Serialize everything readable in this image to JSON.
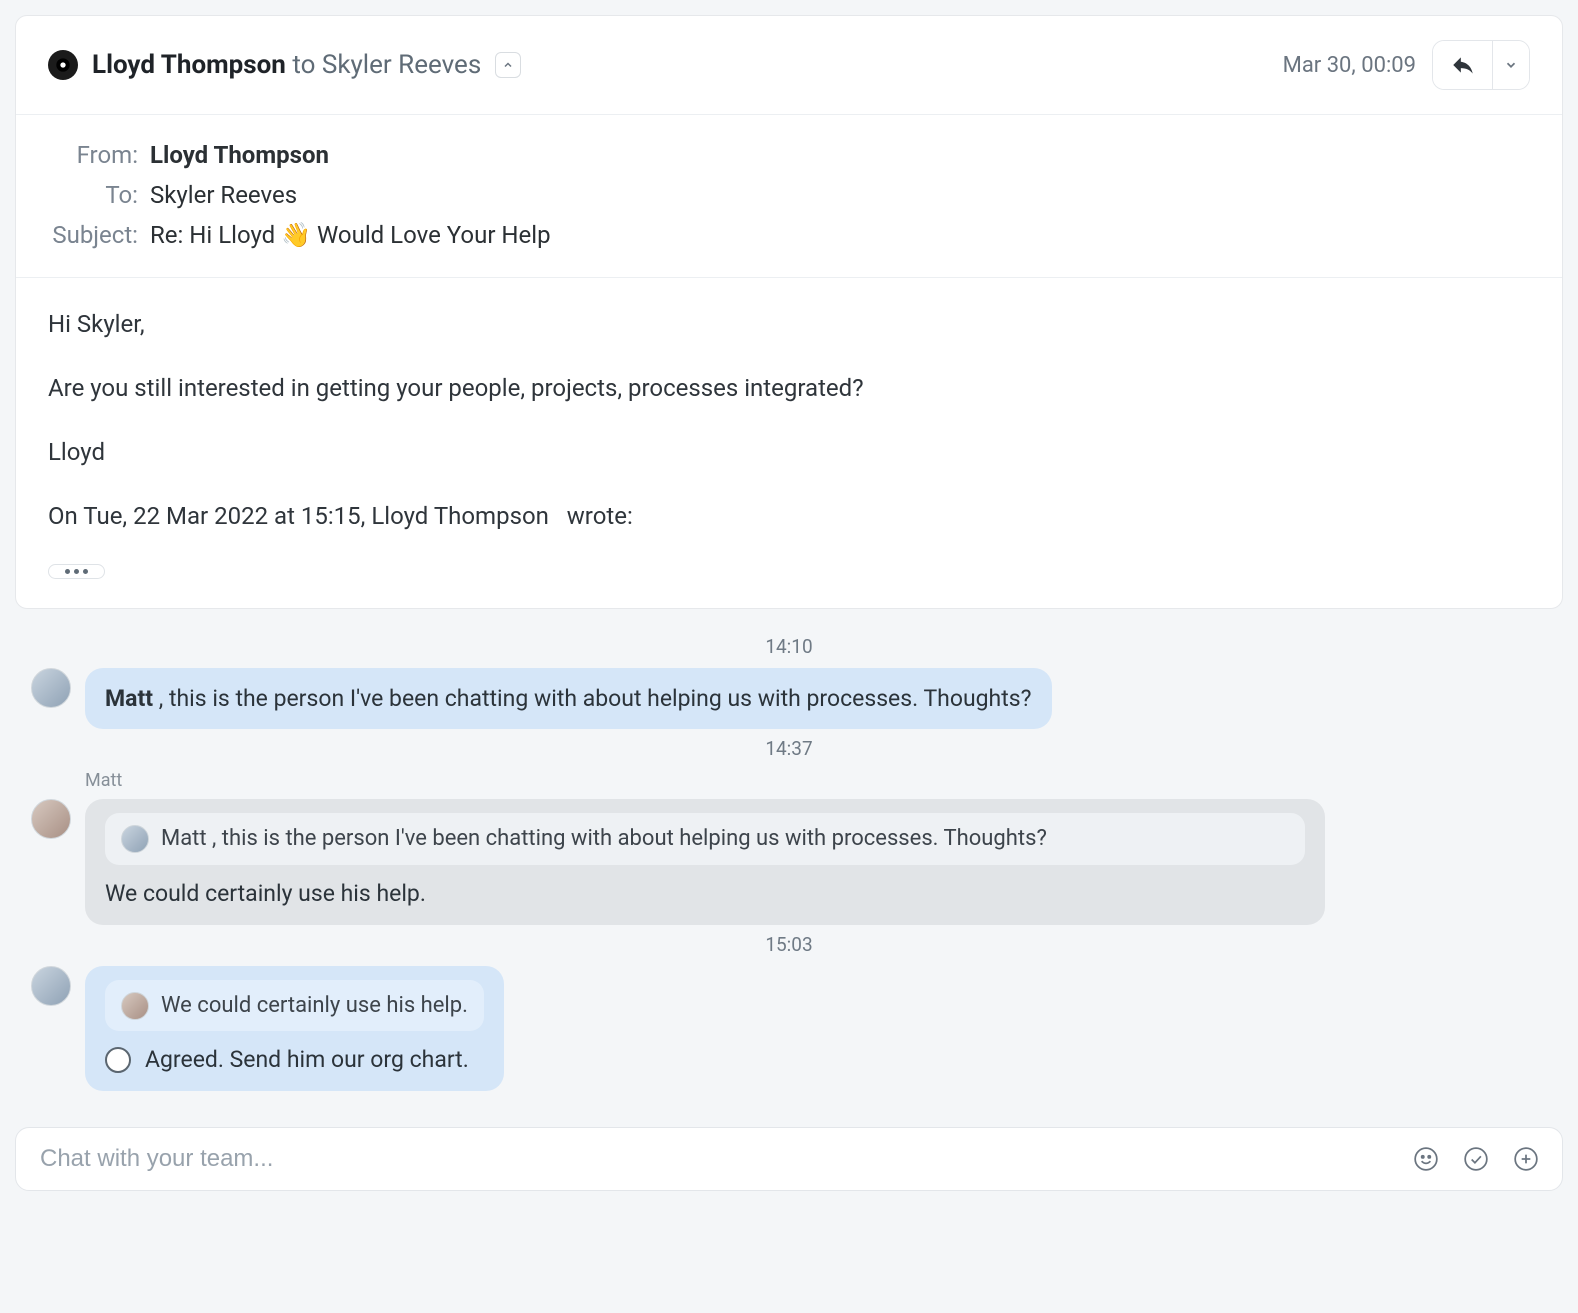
{
  "email": {
    "header": {
      "sender": "Lloyd Thompson",
      "to_word": "to",
      "recipient": "Skyler Reeves",
      "timestamp": "Mar 30, 00:09"
    },
    "meta": {
      "from_label": "From:",
      "to_label": "To:",
      "subject_label": "Subject:",
      "from_value": "Lloyd Thompson",
      "to_value": "Skyler Reeves",
      "subject_value": "Re: Hi Lloyd 👋 Would Love Your Help"
    },
    "body": {
      "greeting": "Hi Skyler,",
      "line1": "Are you still interested in getting your people, projects, processes integrated?",
      "signoff": "Lloyd",
      "quoted_intro_1": "On Tue, 22 Mar 2022 at 15:15, Lloyd Thompson",
      "quoted_intro_2": "wrote:"
    }
  },
  "chat": {
    "ts1": "14:10",
    "msg1_mention": "Matt",
    "msg1_rest": " , this is the person I've been chatting with about helping us with processes. Thoughts?",
    "ts2": "14:37",
    "msg2_sender": "Matt",
    "msg2_quote": "Matt , this is the person I've been chatting with about helping us with processes. Thoughts?",
    "msg2_text": "We could certainly use his help.",
    "ts3": "15:03",
    "msg3_quote": "We could certainly use his help.",
    "msg3_text": "Agreed. Send him our org chart."
  },
  "composer": {
    "placeholder": "Chat with your team..."
  }
}
